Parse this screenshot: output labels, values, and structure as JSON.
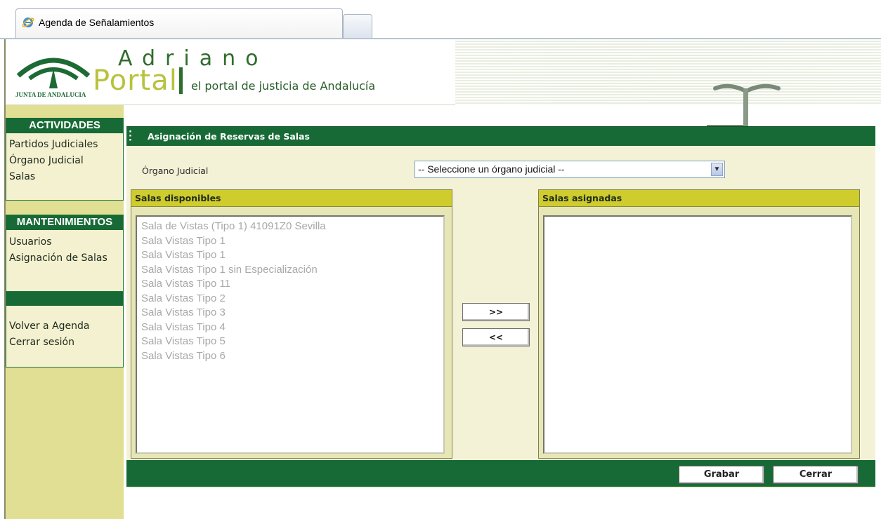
{
  "browser": {
    "tab_title": "Agenda de Señalamientos"
  },
  "header": {
    "logo_caption": "JUNTA DE ANDALUCIA",
    "app_name": "Adriano",
    "portal_word": "Portal",
    "tagline": "el portal de justicia de Andalucía"
  },
  "sidebar": {
    "actividades": {
      "heading": "ACTIVIDADES",
      "items": [
        "Partidos Judiciales",
        "Órgano Judicial",
        "Salas"
      ]
    },
    "mantenimientos": {
      "heading": "MANTENIMIENTOS",
      "items": [
        "Usuarios",
        "Asignación de Salas"
      ]
    },
    "session": {
      "items": [
        "Volver a Agenda",
        "Cerrar sesión"
      ]
    }
  },
  "main": {
    "title": "Asignación de Reservas de Salas",
    "organo_label": "Órgano Judicial",
    "organo_select_value": "-- Seleccione un órgano judicial --",
    "disponibles": {
      "heading": "Salas disponibles",
      "options": [
        "Sala de Vistas (Tipo 1) 41091Z0 Sevilla",
        "Sala Vistas Tipo 1",
        "Sala Vistas Tipo 1",
        "Sala Vistas Tipo 1 sin Especialización",
        "Sala Vistas Tipo 11",
        "Sala Vistas Tipo 2",
        "Sala Vistas Tipo 3",
        "Sala Vistas Tipo 4",
        "Sala Vistas Tipo 5",
        "Sala Vistas Tipo 6"
      ]
    },
    "asignadas": {
      "heading": "Salas asignadas",
      "options": []
    },
    "add_label": ">>",
    "remove_label": "<<",
    "save_label": "Grabar",
    "close_label": "Cerrar"
  },
  "colors": {
    "primary_green": "#176a35",
    "panel_yellow": "#cfcc2d",
    "sidebar_bg": "#e0df94",
    "content_bg": "#f4f2d6"
  }
}
